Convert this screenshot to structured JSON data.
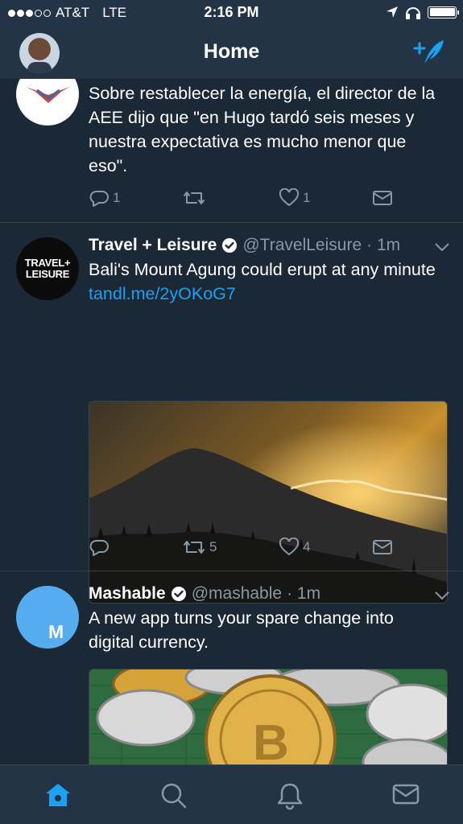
{
  "status_bar": {
    "carrier": "AT&T",
    "network": "LTE",
    "time": "2:16 PM"
  },
  "header": {
    "title": "Home"
  },
  "tweets": [
    {
      "text": "Sobre restablecer la energía, el director de la AEE dijo que \"en Hugo tardó seis meses y nuestra expectativa es mucho menor que eso\".",
      "replies": "1",
      "retweets": "",
      "likes": "1"
    },
    {
      "name": "Travel + Leisure",
      "handle": "@TravelLeisure",
      "time": "· 1m",
      "avatar_text": "TRAVEL+\nLEISURE",
      "text": "Bali's Mount Agung could erupt at any minute ",
      "link": "tandl.me/2yOKoG7",
      "replies": "",
      "retweets": "5",
      "likes": "4"
    },
    {
      "name": "Mashable",
      "handle": "@mashable",
      "time": "· 1m",
      "avatar_text": "M",
      "text": "A new app turns your spare change into digital currency."
    }
  ],
  "icons": {
    "compose": "compose-tweet-icon",
    "reply": "reply-icon",
    "retweet": "retweet-icon",
    "like": "heart-icon",
    "dm": "envelope-icon",
    "home": "home-icon",
    "search": "search-icon",
    "notifications": "bell-icon",
    "messages": "envelope-icon"
  },
  "colors": {
    "background": "#1b2836",
    "bar": "#243447",
    "accent": "#1da1f2",
    "muted": "#8899a6",
    "divider": "#38444d"
  }
}
